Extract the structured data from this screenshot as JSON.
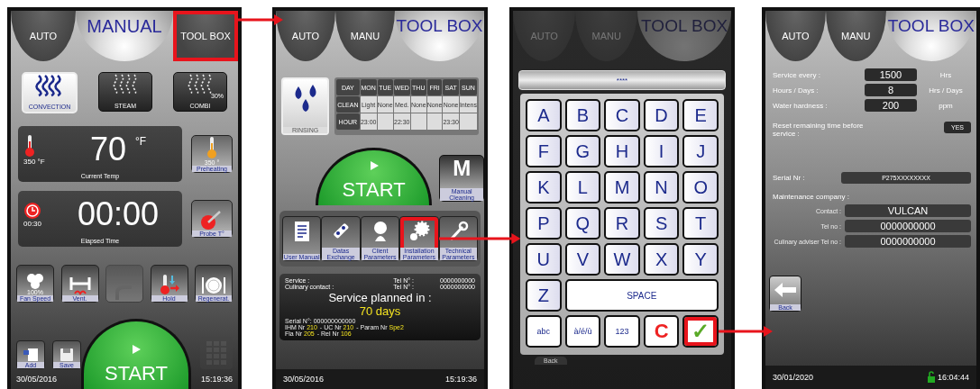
{
  "screens": [
    {
      "kind": "manual",
      "dimmed": false,
      "tabs": [
        {
          "label": "AUTO",
          "selected": false,
          "highlighted": false
        },
        {
          "label": "MANUAL",
          "selected": true,
          "highlighted": false
        },
        {
          "label": "TOOL BOX",
          "selected": false,
          "highlighted": true
        }
      ],
      "modes": [
        {
          "label": "CONVECTION",
          "selected": true
        },
        {
          "label": "STEAM",
          "selected": false
        },
        {
          "label": "COMBI",
          "selected": false,
          "badge": "30%"
        }
      ],
      "temperature": {
        "setpoint": "350 °F",
        "value": "70",
        "unit": "°F",
        "caption": "Current Temp"
      },
      "preheating": {
        "value": "350 °",
        "label": "Preheating"
      },
      "timer": {
        "setpoint": "00:30",
        "value": "00:00",
        "caption": "Elapsed Time"
      },
      "probe": {
        "label": "Probe T°"
      },
      "functions": [
        {
          "label": "Fan Speed",
          "value": "100%",
          "disabled": false
        },
        {
          "label": "Vent.",
          "disabled": false
        },
        {
          "disabled": true
        },
        {
          "label": "Hold",
          "disabled": false
        },
        {
          "label": "Regenerat.",
          "disabled": false
        }
      ],
      "shortcuts": [
        {
          "label": "Add"
        },
        {
          "label": "Save"
        }
      ],
      "keypad": {
        "disabled": true
      },
      "start": "START",
      "date": "30/05/2016",
      "time": "15:19:36"
    },
    {
      "kind": "toolbox",
      "dimmed": false,
      "tabs": [
        {
          "label": "AUTO",
          "selected": false,
          "highlighted": false
        },
        {
          "label": "MANU",
          "selected": false,
          "highlighted": false
        },
        {
          "label": "TOOL BOX",
          "selected": true,
          "highlighted": false
        }
      ],
      "rinsing": {
        "label": "RINSING"
      },
      "schedule": {
        "columns": [
          "DAY",
          "MON",
          "TUE",
          "WED",
          "THU",
          "FRI",
          "SAT",
          "SUN"
        ],
        "rows": [
          [
            "CLEAN",
            "Light",
            "None",
            "Med.",
            "None",
            "None",
            "None",
            "Intens"
          ],
          [
            "HOUR",
            "23:00",
            null,
            "22:30",
            null,
            null,
            "23:30",
            null
          ]
        ]
      },
      "start": "START",
      "manual_cleaning": {
        "letter": "M",
        "label": "Manual Cleaning"
      },
      "tools": [
        {
          "label": "User Manual",
          "highlighted": false
        },
        {
          "label": "Datas Exchange",
          "highlighted": false
        },
        {
          "label": "Client Parameters",
          "highlighted": false
        },
        {
          "label": "Installation Parameters",
          "highlighted": true
        },
        {
          "label": "Technical Parameters",
          "highlighted": false
        }
      ],
      "contacts": [
        {
          "label": "Service :",
          "tel_label": "Tel N° :",
          "tel": "0000000000"
        },
        {
          "label": "Culinary contact :",
          "tel_label": "Tel N° :",
          "tel": "0000000000"
        }
      ],
      "service_planned": {
        "label": "Service planned in :",
        "value": "70 days"
      },
      "versions": {
        "serial_label": "Serial N°:",
        "serial": "000000000000",
        "lines": [
          [
            {
              "label": "IHM Nr",
              "value": "210"
            },
            {
              "label": "- UC Nr",
              "value": "210"
            },
            {
              "label": "- Param Nr",
              "value": "Spe2"
            }
          ],
          [
            {
              "label": "Fla Nr",
              "value": "205"
            },
            {
              "label": "- Rel Nr",
              "value": "106"
            }
          ]
        ]
      },
      "date": "30/05/2016",
      "time": "15:19:36"
    },
    {
      "kind": "keyboard",
      "dimmed": true,
      "tabs": [
        {
          "label": "AUTO",
          "selected": false,
          "highlighted": false
        },
        {
          "label": "MANU",
          "selected": false,
          "highlighted": false
        },
        {
          "label": "TOOL BOX",
          "selected": true,
          "highlighted": false
        }
      ],
      "display": "****",
      "keys": [
        {
          "kind": "letter",
          "label": "A",
          "highlighted": false
        },
        {
          "kind": "letter",
          "label": "B",
          "highlighted": false
        },
        {
          "kind": "letter",
          "label": "C",
          "highlighted": false
        },
        {
          "kind": "letter",
          "label": "D",
          "highlighted": false
        },
        {
          "kind": "letter",
          "label": "E",
          "highlighted": false
        },
        {
          "kind": "letter",
          "label": "F",
          "highlighted": false
        },
        {
          "kind": "letter",
          "label": "G",
          "highlighted": false
        },
        {
          "kind": "letter",
          "label": "H",
          "highlighted": false
        },
        {
          "kind": "letter",
          "label": "I",
          "highlighted": false
        },
        {
          "kind": "letter",
          "label": "J",
          "highlighted": false
        },
        {
          "kind": "letter",
          "label": "K",
          "highlighted": false
        },
        {
          "kind": "letter",
          "label": "L",
          "highlighted": false
        },
        {
          "kind": "letter",
          "label": "M",
          "highlighted": false
        },
        {
          "kind": "letter",
          "label": "N",
          "highlighted": false
        },
        {
          "kind": "letter",
          "label": "O",
          "highlighted": false
        },
        {
          "kind": "letter",
          "label": "P",
          "highlighted": false
        },
        {
          "kind": "letter",
          "label": "Q",
          "highlighted": false
        },
        {
          "kind": "letter",
          "label": "R",
          "highlighted": false
        },
        {
          "kind": "letter",
          "label": "S",
          "highlighted": false
        },
        {
          "kind": "letter",
          "label": "T",
          "highlighted": false
        },
        {
          "kind": "letter",
          "label": "U",
          "highlighted": false
        },
        {
          "kind": "letter",
          "label": "V",
          "highlighted": false
        },
        {
          "kind": "letter",
          "label": "W",
          "highlighted": false
        },
        {
          "kind": "letter",
          "label": "X",
          "highlighted": false
        },
        {
          "kind": "letter",
          "label": "Y",
          "highlighted": false
        },
        {
          "kind": "letter",
          "label": "Z",
          "highlighted": false
        },
        {
          "kind": "space",
          "label": "SPACE",
          "highlighted": false
        },
        {
          "kind": "mode",
          "label": "abc",
          "highlighted": false
        },
        {
          "kind": "mode",
          "label": "à/é/ù",
          "highlighted": false
        },
        {
          "kind": "mode",
          "label": "123",
          "highlighted": false
        },
        {
          "kind": "clear",
          "label": "C",
          "highlighted": false
        },
        {
          "kind": "ok",
          "label": "✓",
          "highlighted": true
        }
      ],
      "back": "Back"
    },
    {
      "kind": "settings",
      "dimmed": false,
      "tabs": [
        {
          "label": "AUTO",
          "selected": false,
          "highlighted": false
        },
        {
          "label": "MANU",
          "selected": false,
          "highlighted": false
        },
        {
          "label": "TOOL BOX",
          "selected": true,
          "highlighted": false
        }
      ],
      "settings": [
        {
          "label": "Service every :",
          "value": "1500",
          "unit": "Hrs"
        },
        {
          "label": "Hours / Days :",
          "value": "8",
          "unit": "Hrs / Days"
        },
        {
          "label": "Water hardness :",
          "value": "200",
          "unit": "ppm"
        }
      ],
      "reset": {
        "label": "Reset remaining time before service :",
        "button": "YES"
      },
      "serial": {
        "label": "Serial Nr :",
        "value": "P275XXXXXXXX"
      },
      "maintenance": {
        "label": "Maintenance company :",
        "fields": [
          {
            "label": "Contact :",
            "value": "VULCAN"
          },
          {
            "label": "Tel no :",
            "value": "0000000000"
          },
          {
            "label": "Culinary adviser Tel no :",
            "value": "0000000000"
          }
        ]
      },
      "back": "Back",
      "date": "30/01/2020",
      "unlocked": true,
      "time": "16:04:44"
    }
  ]
}
